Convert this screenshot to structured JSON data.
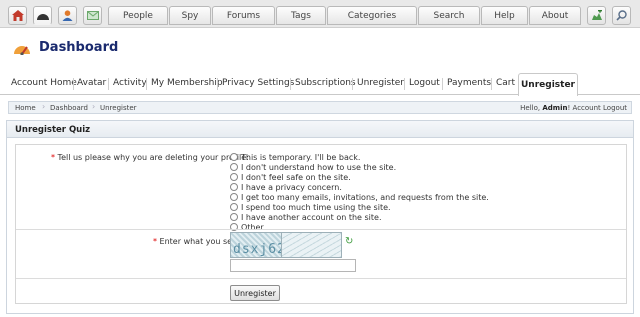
{
  "topnav": {
    "icons": [
      "home-icon",
      "dashboard-icon",
      "profile-icon",
      "mail-icon"
    ],
    "tabs": [
      {
        "label": "People"
      },
      {
        "label": "Spy"
      },
      {
        "label": "Forums"
      },
      {
        "label": "Tags"
      },
      {
        "label": "Categories"
      },
      {
        "label": "Search"
      },
      {
        "label": "Help"
      },
      {
        "label": "About"
      }
    ],
    "right_icons": [
      "add-icon",
      "search-icon"
    ]
  },
  "header": {
    "title": "Dashboard"
  },
  "subtabs": {
    "items": [
      "Account Home",
      "Avatar",
      "Activity",
      "My Membership",
      "Privacy Settings",
      "Subscriptions",
      "Unregister",
      "Logout",
      "Payments",
      "Cart"
    ],
    "active": "Unregister"
  },
  "breadcrumb": {
    "items": [
      "Home",
      "Dashboard",
      "Unregister"
    ],
    "user_prefix": "Hello,",
    "user_name": "Admin",
    "user_suffix": "!",
    "account_link": "Account",
    "logout_link": "Logout"
  },
  "panel": {
    "title": "Unregister Quiz",
    "question_label": "Tell us please why you are deleting your profile:",
    "required_mark": "*",
    "options": [
      "This is temporary. I'll be back.",
      "I don't understand how to use the site.",
      "I don't feel safe on the site.",
      "I have a privacy concern.",
      "I get too many emails, invitations, and requests from the site.",
      "I spend too much time using the site.",
      "I have another account on the site.",
      "Other."
    ],
    "captcha_label": "Enter what you see:",
    "captcha_text": "dsxj62",
    "captcha_value": "",
    "submit_label": "Unregister"
  },
  "colors": {
    "title": "#1a2a6e",
    "required": "#dd0000",
    "refresh": "#3d9b3d"
  }
}
